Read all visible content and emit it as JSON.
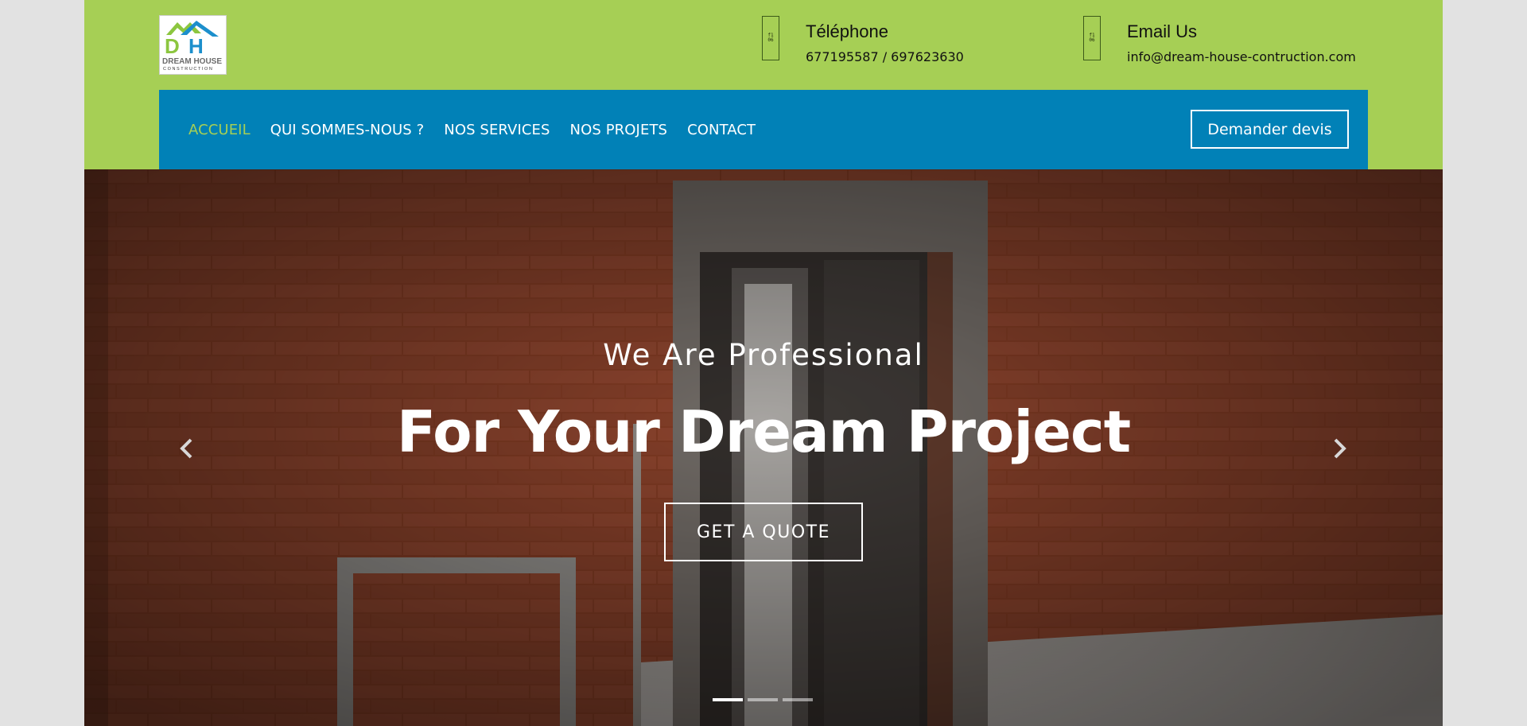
{
  "brand": {
    "logo_text_line1": "DREAM HOUSE",
    "logo_text_line2": "CONSTRUCTION",
    "colors": {
      "green": "#a6cf55",
      "blue": "#0181b7",
      "white": "#ffffff"
    }
  },
  "contact": {
    "phone": {
      "icon": "phone-icon",
      "title": "Téléphone",
      "value": "677195587 / 697623630"
    },
    "email": {
      "icon": "email-icon",
      "title": "Email Us",
      "value": "info@dream-house-contruction.com"
    }
  },
  "nav": {
    "items": [
      {
        "label": "ACCUEIL",
        "active": true
      },
      {
        "label": "QUI SOMMES-NOUS ?",
        "active": false
      },
      {
        "label": "NOS SERVICES",
        "active": false
      },
      {
        "label": "NOS PROJETS",
        "active": false
      },
      {
        "label": "CONTACT",
        "active": false
      }
    ],
    "cta_label": "Demander devis"
  },
  "hero": {
    "subtitle": "We Are Professional",
    "title": "For Your Dream Project",
    "button_label": "GET A QUOTE",
    "slide_count": 3,
    "active_slide": 1
  }
}
